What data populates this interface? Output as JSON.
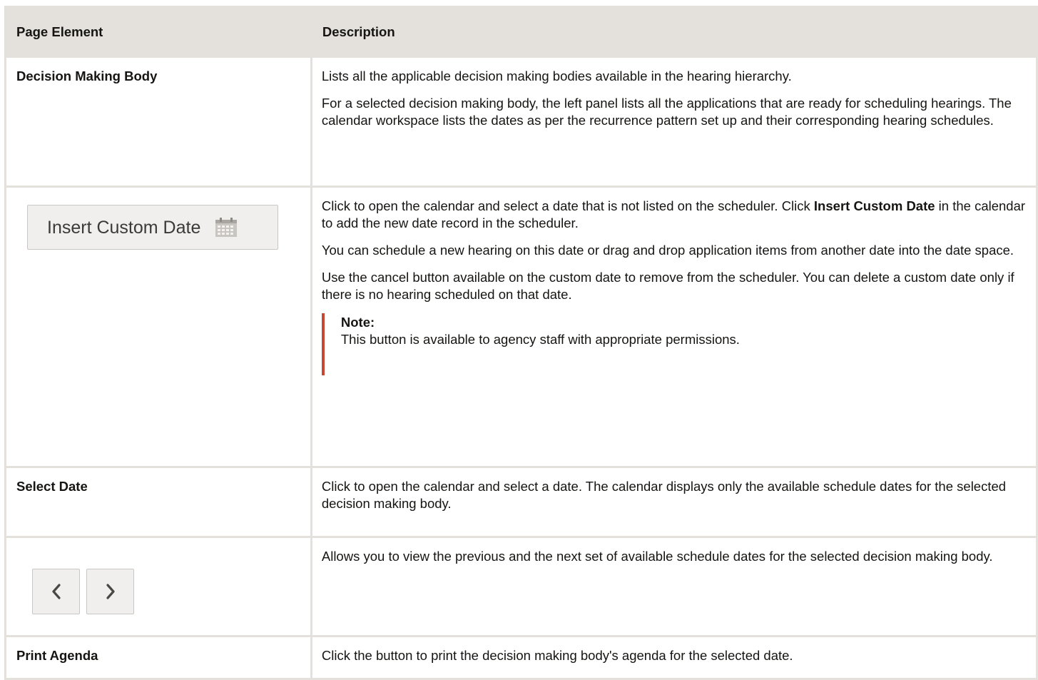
{
  "table": {
    "headers": [
      "Page Element",
      "Description"
    ],
    "rows": [
      {
        "element": "Decision Making Body",
        "paragraphs": [
          "Lists all the applicable decision making bodies available in the hearing hierarchy.",
          "For a selected decision making body, the left panel lists all the applications that are ready for scheduling hearings. The calendar workspace lists the dates as per the recurrence pattern set up and their corresponding hearing schedules."
        ]
      },
      {
        "element_button": "Insert Custom Date",
        "element_icon": "calendar-icon",
        "p1_before": "Click to open the calendar and select a date that is not listed on the scheduler. Click ",
        "p1_bold": "Insert Custom Date",
        "p1_after": " in the calendar to add the new date record in the scheduler.",
        "paragraphs": [
          "You can schedule a new hearing on this date or drag and drop application items from another date into the date space.",
          "Use the cancel button available on the custom date to remove from the scheduler. You can delete a custom date only if there is no hearing scheduled on that date."
        ],
        "note_title": "Note:",
        "note_text": "This button is available to agency staff with appropriate permissions."
      },
      {
        "element": "Select Date",
        "paragraphs": [
          "Click to open the calendar and select a date. The calendar displays only the available schedule dates for the selected decision making body."
        ]
      },
      {
        "element_icons": [
          "chevron-left-icon",
          "chevron-right-icon"
        ],
        "paragraphs": [
          "Allows you to view the previous and the next set of available schedule dates for the selected decision making body."
        ]
      },
      {
        "element": "Print Agenda",
        "paragraphs": [
          "Click the button to print the decision making body's agenda for the selected date."
        ]
      }
    ]
  },
  "colors": {
    "border": "#e4e1dc",
    "note_accent": "#c74634",
    "button_bg": "#f0efed"
  }
}
